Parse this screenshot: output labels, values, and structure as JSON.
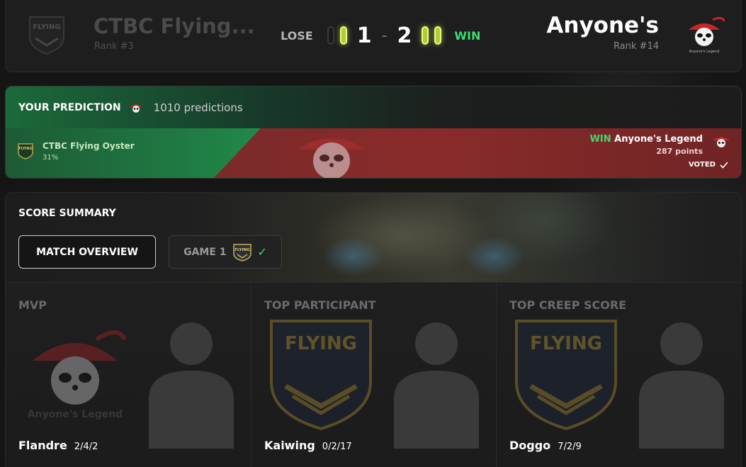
{
  "header": {
    "left_team": {
      "name": "CTBC Flying...",
      "rank": "Rank #3"
    },
    "right_team": {
      "name": "Anyone's",
      "rank": "Rank #14"
    },
    "lose_label": "LOSE",
    "win_label": "WIN",
    "score_left": "1",
    "score_dash": "-",
    "score_right": "2",
    "left_game_wins": [
      0,
      1
    ],
    "right_game_wins": [
      1,
      1
    ],
    "left_logo_text": "FLYING",
    "right_logo_text": "Anyone's Legend"
  },
  "prediction": {
    "title": "YOUR PREDICTION",
    "count": "1010 predictions",
    "left_team": {
      "name": "CTBC Flying Oyster",
      "percent": "31%",
      "logo_text": "FLYING"
    },
    "right_team": {
      "result": "WIN",
      "name": "Anyone's Legend",
      "points": "287 points"
    },
    "voted_label": "VOTED",
    "colors": {
      "left": "#1f7a42",
      "right": "#8a2b2b",
      "win_text": "#3ddc6c"
    }
  },
  "summary": {
    "title": "SCORE SUMMARY",
    "tabs": [
      {
        "label": "MATCH OVERVIEW",
        "active": true
      },
      {
        "label": "GAME 1",
        "active": false,
        "completed": true,
        "logo_text": "FLYING"
      }
    ],
    "stats": [
      {
        "label": "MVP",
        "player": "Flandre",
        "kda": "2/4/2",
        "team_icon": "anyones-legend-logo",
        "logo_text": "Anyone's Legend"
      },
      {
        "label": "TOP PARTICIPANT",
        "player": "Kaiwing",
        "kda": "0/2/17",
        "team_icon": "flying-oyster-logo",
        "logo_text": "FLYING"
      },
      {
        "label": "TOP CREEP SCORE",
        "player": "Doggo",
        "kda": "7/2/9",
        "team_icon": "flying-oyster-logo",
        "logo_text": "FLYING"
      }
    ]
  },
  "theme": {
    "accent_green": "#3ddc6c",
    "pill_active": "#e6ff7a",
    "background": "#141414"
  }
}
